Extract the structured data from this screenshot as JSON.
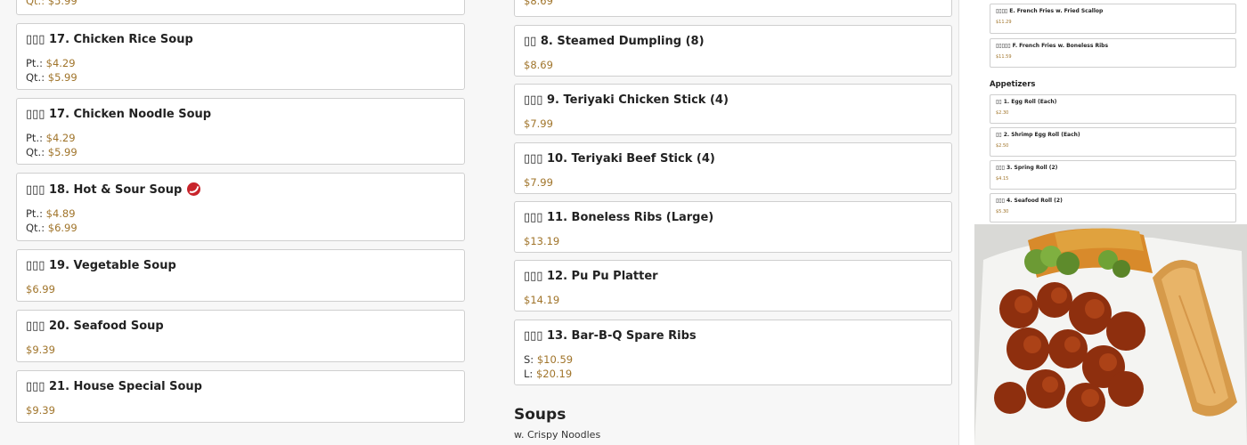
{
  "left": {
    "top_price": "Qt.: $5.99",
    "items": [
      {
        "title": "▯▯▯ 17. Chicken Rice Soup",
        "pt_label": "Pt.:",
        "pt": "$4.29",
        "qt_label": "Qt.:",
        "qt": "$5.99"
      },
      {
        "title": "▯▯▯ 17. Chicken Noodle Soup",
        "pt_label": "Pt.:",
        "pt": "$4.29",
        "qt_label": "Qt.:",
        "qt": "$5.99"
      },
      {
        "title": "▯▯▯ 18. Hot & Sour Soup",
        "pt_label": "Pt.:",
        "pt": "$4.89",
        "qt_label": "Qt.:",
        "qt": "$6.99",
        "spicy": true
      },
      {
        "title": "▯▯▯ 19. Vegetable Soup",
        "price": "$6.99"
      },
      {
        "title": "▯▯▯ 20. Seafood Soup",
        "price": "$9.39"
      },
      {
        "title": "▯▯▯ 21. House Special Soup",
        "price": "$9.39"
      }
    ]
  },
  "middle": {
    "top_price": "$8.69",
    "items": [
      {
        "title": "▯▯ 8. Steamed Dumpling (8)",
        "price": "$8.69"
      },
      {
        "title": "▯▯▯ 9. Teriyaki Chicken Stick (4)",
        "price": "$7.99"
      },
      {
        "title": "▯▯▯ 10. Teriyaki Beef Stick (4)",
        "price": "$7.99"
      },
      {
        "title": "▯▯▯ 11. Boneless Ribs (Large)",
        "price": "$13.19"
      },
      {
        "title": "▯▯▯ 12. Pu Pu Platter",
        "price": "$14.19"
      },
      {
        "title": "▯▯▯ 13. Bar-B-Q Spare Ribs",
        "s_label": "S:",
        "s": "$10.59",
        "l_label": "L:",
        "l": "$20.19"
      }
    ],
    "section_title": "Soups",
    "section_subtitle": "w. Crispy Noodles"
  },
  "right": {
    "items_top": [
      {
        "title": "▯▯▯▯ E. French Fries w. Fried Scallop",
        "price": "$11.29"
      },
      {
        "title": "▯▯▯▯▯ F. French Fries w. Boneless Ribs",
        "price": "$11.59"
      }
    ],
    "section_title": "Appetizers",
    "items": [
      {
        "title": "▯▯ 1. Egg Roll (Each)",
        "price": "$2.30"
      },
      {
        "title": "▯▯ 2. Shrimp Egg Roll (Each)",
        "price": "$2.50"
      },
      {
        "title": "▯▯▯ 3. Spring Roll (2)",
        "price": "$4.15"
      },
      {
        "title": "▯▯▯ 4. Seafood Roll (2)",
        "price": "$5.30"
      }
    ]
  },
  "icons": {
    "spicy": "spicy-pepper-icon"
  },
  "colors": {
    "price": "#a0742a",
    "spicy": "#c8242b"
  }
}
